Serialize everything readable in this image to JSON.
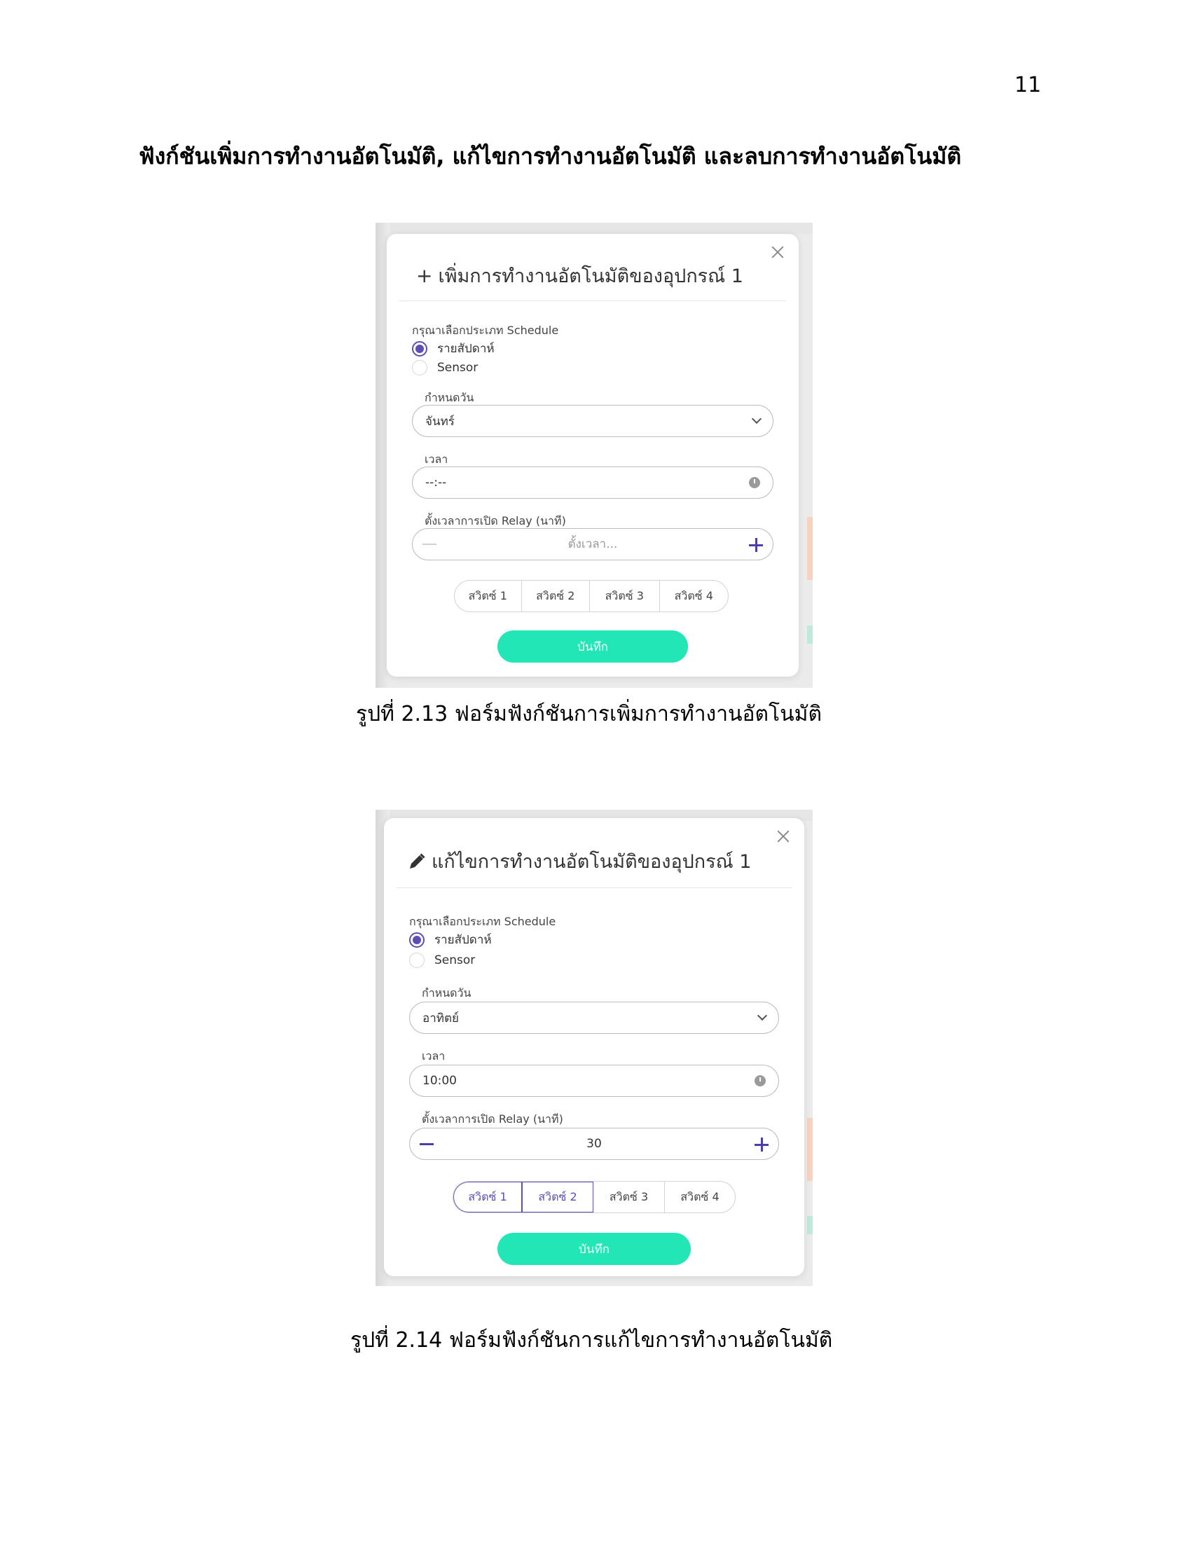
{
  "page": {
    "number": "11",
    "heading": "ฟังก์ชันเพิ่มการทำงานอัตโนมัติ, แก้ไขการทำงานอัตโนมัติ และลบการทำงานอัตโนมัติ"
  },
  "figures": [
    {
      "caption": "รูปที่ 2.13 ฟอร์มฟังก์ชันการเพิ่มการทำงานอัตโนมัติ",
      "modal": {
        "title": "เพิ่มการทำงานอัตโนมัติของอุปกรณ์ 1",
        "title_icon": "plus-icon",
        "schedule_type_label": "กรุณาเลือกประเภท Schedule",
        "schedule_options": [
          "รายสัปดาห์",
          "Sensor"
        ],
        "schedule_selected": "รายสัปดาห์",
        "day_label": "กำหนดวัน",
        "day_value": "จันทร์",
        "time_label": "เวลา",
        "time_value": "--:--",
        "relay_label": "ตั้งเวลาการเปิด Relay (นาที)",
        "relay_value": "",
        "relay_placeholder": "ตั้งเวลา...",
        "switches": [
          "สวิตซ์ 1",
          "สวิตซ์ 2",
          "สวิตซ์ 3",
          "สวิตซ์ 4"
        ],
        "selected_switches": [],
        "save_label": "บันทึก"
      }
    },
    {
      "caption": "รูปที่ 2.14 ฟอร์มฟังก์ชันการแก้ไขการทำงานอัตโนมัติ",
      "modal": {
        "title": "แก้ไขการทำงานอัตโนมัติของอุปกรณ์ 1",
        "title_icon": "pencil-icon",
        "schedule_type_label": "กรุณาเลือกประเภท Schedule",
        "schedule_options": [
          "รายสัปดาห์",
          "Sensor"
        ],
        "schedule_selected": "รายสัปดาห์",
        "day_label": "กำหนดวัน",
        "day_value": "อาทิตย์",
        "time_label": "เวลา",
        "time_value": "10:00",
        "relay_label": "ตั้งเวลาการเปิด Relay (นาที)",
        "relay_value": "30",
        "relay_placeholder": "",
        "switches": [
          "สวิตซ์ 1",
          "สวิตซ์ 2",
          "สวิตซ์ 3",
          "สวิตซ์ 4"
        ],
        "selected_switches": [
          "สวิตซ์ 1",
          "สวิตซ์ 2"
        ],
        "save_label": "บันทึก"
      }
    }
  ],
  "colors": {
    "accent": "#5b4fb5",
    "save_button": "#22e6b5"
  }
}
